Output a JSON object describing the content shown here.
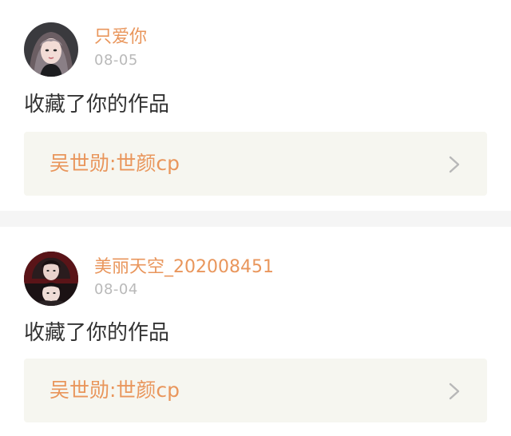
{
  "accent_color": "#e9965c",
  "notifications": [
    {
      "username": "只爱你",
      "date": "08-05",
      "action": "收藏了你的作品",
      "work_title": "吴世勋:世颜cp",
      "avatar_icon": "avatar-girl-icon",
      "chevron_icon": "chevron-right-icon"
    },
    {
      "username": "美丽天空_202008451",
      "date": "08-04",
      "action": "收藏了你的作品",
      "work_title": "吴世勋:世颜cp",
      "avatar_icon": "avatar-couple-icon",
      "chevron_icon": "chevron-right-icon"
    }
  ]
}
